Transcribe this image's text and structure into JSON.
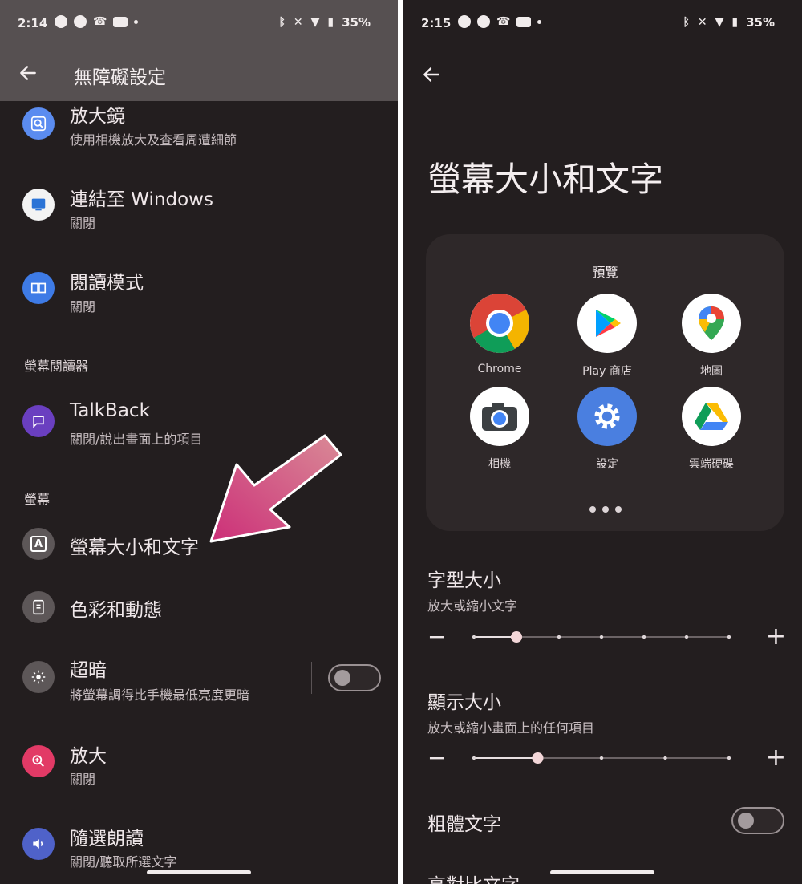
{
  "left": {
    "status": {
      "time": "2:14",
      "battery": "35%"
    },
    "appbar": {
      "title": "無障礙設定"
    },
    "rows": {
      "magnifier": {
        "title": "放大鏡",
        "subtitle": "使用相機放大及查看周遭細節"
      },
      "windows": {
        "title": "連結至 Windows",
        "subtitle": "關閉"
      },
      "reading_mode": {
        "title": "閱讀模式",
        "subtitle": "關閉"
      },
      "talkback": {
        "title": "TalkBack",
        "subtitle": "關閉/說出畫面上的項目"
      },
      "display_size": {
        "title": "螢幕大小和文字",
        "icon_glyph": "A"
      },
      "color_motion": {
        "title": "色彩和動態"
      },
      "extra_dim": {
        "title": "超暗",
        "subtitle": "將螢幕調得比手機最低亮度更暗",
        "enabled": false
      },
      "magnification": {
        "title": "放大",
        "subtitle": "關閉"
      },
      "select_to_speak": {
        "title": "隨選朗讀",
        "subtitle": "關閉/聽取所選文字"
      }
    },
    "sections": {
      "screen_reader": "螢幕閱讀器",
      "display": "螢幕"
    },
    "colors": {
      "arrow": "#d9488a"
    }
  },
  "right": {
    "status": {
      "time": "2:15",
      "battery": "35%"
    },
    "title": "螢幕大小和文字",
    "preview": {
      "label": "預覽",
      "apps": [
        {
          "label": "Chrome",
          "icon": "chrome-icon"
        },
        {
          "label": "Play 商店",
          "icon": "play-store-icon"
        },
        {
          "label": "地圖",
          "icon": "maps-icon"
        },
        {
          "label": "相機",
          "icon": "camera-icon"
        },
        {
          "label": "設定",
          "icon": "settings-gear-icon"
        },
        {
          "label": "雲端硬碟",
          "icon": "drive-icon"
        }
      ]
    },
    "font_size": {
      "title": "字型大小",
      "subtitle": "放大或縮小文字",
      "level": 1,
      "levels": 7
    },
    "display_size": {
      "title": "顯示大小",
      "subtitle": "放大或縮小畫面上的任何項目",
      "level": 1,
      "levels": 5
    },
    "bold_text": {
      "title": "粗體文字",
      "enabled": false
    },
    "high_contrast": {
      "title": "高對比文字"
    },
    "colors": {
      "accent": "#f3d6d8",
      "background": "#231e1f"
    }
  }
}
